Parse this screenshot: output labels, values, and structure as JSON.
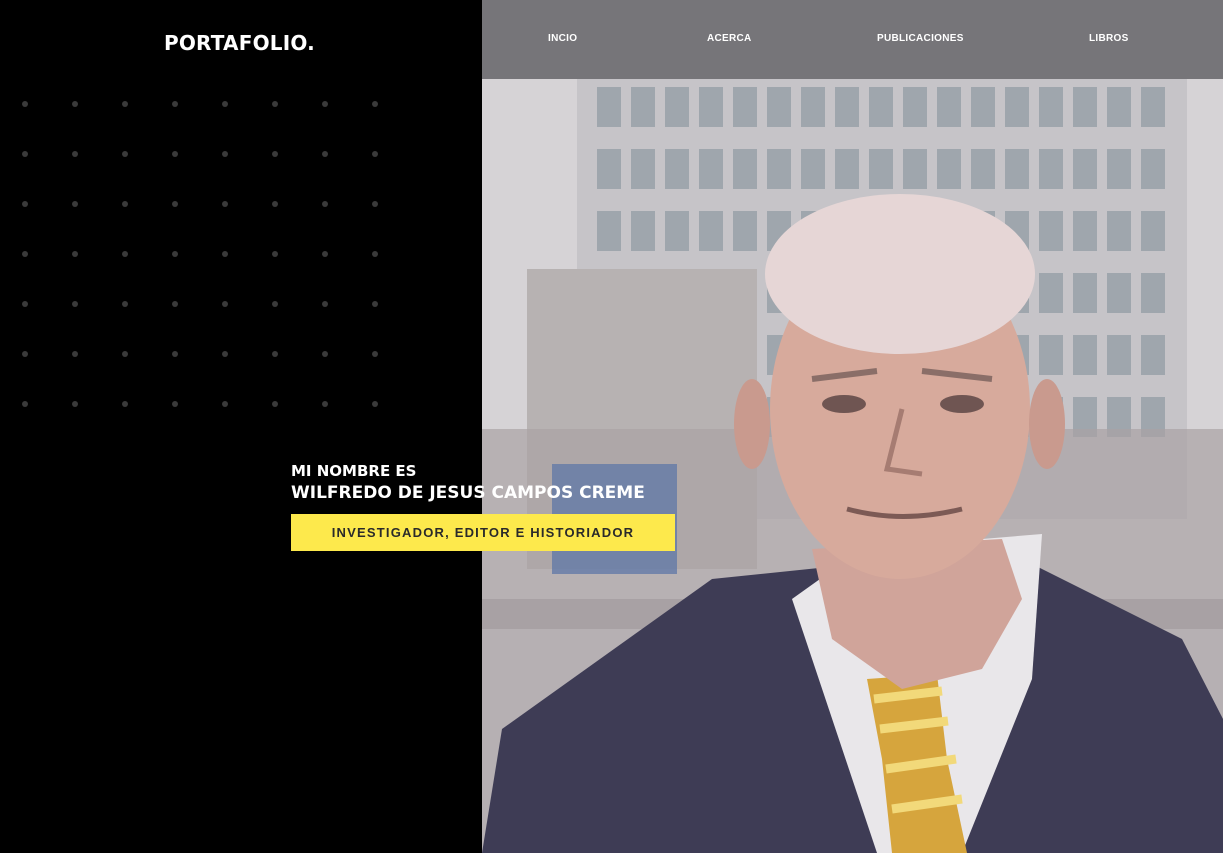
{
  "brand": {
    "title": "PORTAFOLIO."
  },
  "nav": {
    "items": [
      {
        "label": "INCIO"
      },
      {
        "label": "ACERCA"
      },
      {
        "label": "PUBLICACIONES"
      },
      {
        "label": "LIBROS"
      }
    ]
  },
  "hero": {
    "kicker": "MI NOMBRE ES",
    "name": "WILFREDO DE JESUS CAMPOS CREME",
    "role": "INVESTIGADOR, EDITOR E HISTORIADOR"
  },
  "colors": {
    "background": "#000000",
    "nav_bg": "#767579",
    "accent": "#fde94c",
    "dot": "#3a3a3a"
  },
  "icons": [
    "dot-grid-decoration",
    "portrait-photo"
  ]
}
